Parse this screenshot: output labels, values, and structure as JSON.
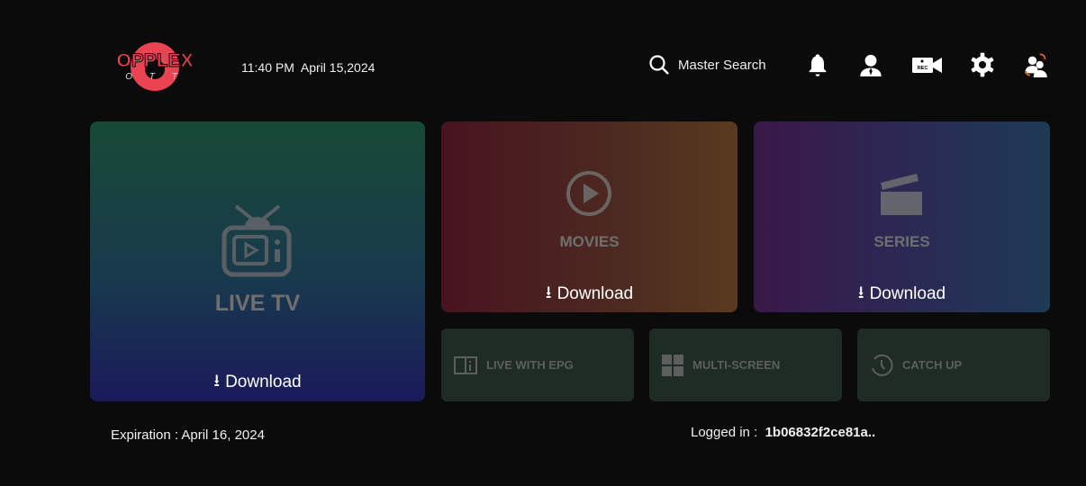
{
  "header": {
    "logo_text": "OPPLEX",
    "logo_sub": "O T T",
    "time": "11:40 PM",
    "date": "April 15,2024",
    "search_label": "Master Search",
    "icons": [
      "bell-icon",
      "user-icon",
      "rec-camera-icon",
      "gear-icon",
      "switch-user-icon"
    ]
  },
  "cards": {
    "live_tv": {
      "title": "LIVE TV",
      "download": "Download"
    },
    "movies": {
      "title": "MOVIES",
      "download": "Download"
    },
    "series": {
      "title": "SERIES",
      "download": "Download"
    }
  },
  "tiles": [
    {
      "label": "LIVE WITH EPG"
    },
    {
      "label": "MULTI-SCREEN"
    },
    {
      "label": "CATCH UP"
    }
  ],
  "footer": {
    "expiration": "Expiration : April 16, 2024",
    "logged_label": "Logged in :",
    "logged_value": "1b06832f2ce81a.."
  },
  "colors": {
    "logo_red": "#ea4453",
    "tile_bg": "#1f2b25"
  }
}
